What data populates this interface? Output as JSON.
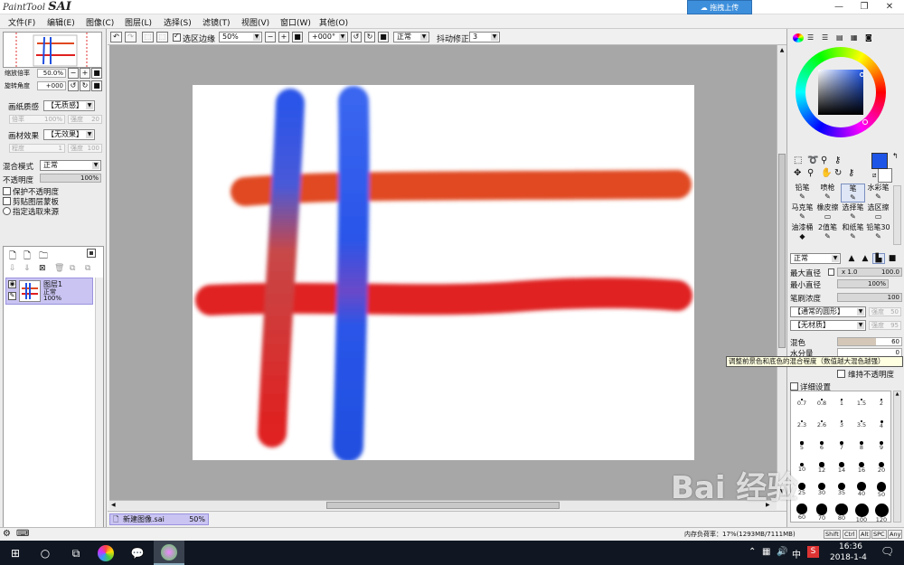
{
  "title": {
    "logo_small": "PaintTool",
    "logo_big": "SAI",
    "upload": "拖拽上传"
  },
  "window_controls": {
    "minimize": "—",
    "restore": "❐",
    "close": "✕"
  },
  "menu": [
    "文件(F)",
    "编辑(E)",
    "图像(C)",
    "图层(L)",
    "选择(S)",
    "滤镜(T)",
    "视图(V)",
    "窗口(W)",
    "其他(O)"
  ],
  "navigator": {
    "zoom_label": "缩放倍率",
    "zoom_value": "50.0%",
    "rotate_label": "旋转角度",
    "rotate_value": "+000"
  },
  "paper": {
    "texture_label": "画纸质感",
    "texture_value": "【无质感】",
    "scale_label": "倍率",
    "scale_value": "100%",
    "strength_label": "强度",
    "strength_value": "20"
  },
  "effect": {
    "label": "画材效果",
    "value": "【无效果】",
    "degree_label": "程度",
    "degree_value": "1",
    "strength_label": "强度",
    "strength_value": "100"
  },
  "blend": {
    "label": "混合模式",
    "value": "正常",
    "opacity_label": "不透明度",
    "opacity_value": "100%"
  },
  "layer_options": [
    "保护不透明度",
    "剪贴图层蒙板",
    "指定选取来源"
  ],
  "layer": {
    "name": "图层1",
    "mode": "正常",
    "opacity": "100%"
  },
  "toolbar": {
    "selection_edge": "选区边缘",
    "zoom": "50%",
    "angle": "+000°",
    "mode": "正常",
    "stabilizer_label": "抖动修正",
    "stabilizer_value": "3"
  },
  "doc_tab": {
    "name": "新建图像.sai",
    "zoom": "50%"
  },
  "canvas_strokes": {
    "colors": {
      "orange": "#e04820",
      "red": "#e02020",
      "blue": "#2050e0",
      "blue_light": "#3a6cf0"
    }
  },
  "colors": {
    "current": "#1e55e6",
    "background": "#ffffff",
    "layer_select": "#c9c4f2",
    "toolbar_bg": "#f0f0f0"
  },
  "tools": [
    [
      "铅笔",
      "喷枪",
      "笔",
      "水彩笔"
    ],
    [
      "马克笔",
      "橡皮擦",
      "选择笔",
      "选区擦"
    ],
    [
      "油漆桶",
      "2值笔",
      "和纸笔",
      "铅笔30"
    ]
  ],
  "tool_icons": [
    "pencil-icon",
    "airbrush-icon",
    "pen-icon",
    "watercolor-icon",
    "marker-icon",
    "eraser-icon",
    "select-pen-icon",
    "select-eraser-icon",
    "bucket-icon",
    "binary-pen-icon",
    "washi-pen-icon",
    "pencil30-icon"
  ],
  "brush": {
    "mode": "正常",
    "max_diameter_label": "最大直径",
    "max_diameter_multiplier": "x 1.0",
    "max_diameter_value": "100.0",
    "min_diameter_label": "最小直径",
    "min_diameter_value": "100%",
    "density_label": "笔刷浓度",
    "density_value": "100",
    "shape_value": "【通常的圆形】",
    "shape_strength_label": "强度",
    "shape_strength_value": "50",
    "texture_value": "【无材质】",
    "texture_strength_label": "强度",
    "texture_strength_value": "95",
    "blending_label": "混色",
    "blending_value": "60",
    "dilution_label": "水分量",
    "dilution_value": "0",
    "keep_opacity": "维持不透明度",
    "advanced": "详细设置"
  },
  "tooltip": "调整前景色和底色的混合程度（数值越大混色越强）",
  "brush_sizes": [
    "0.7",
    "0.8",
    "1",
    "1.5",
    "2",
    "2.3",
    "2.6",
    "3",
    "3.5",
    "4",
    "5",
    "6",
    "7",
    "8",
    "9",
    "10",
    "12",
    "14",
    "16",
    "20",
    "25",
    "30",
    "35",
    "40",
    "50",
    "60",
    "70",
    "80",
    "100",
    "120"
  ],
  "status": {
    "memory": "内存负荷率：17%(1293MB/7111MB)",
    "keys": [
      "Shift",
      "Ctrl",
      "Alt",
      "SPC",
      "Any"
    ]
  },
  "taskbar": {
    "time": "16:36",
    "date": "2018-1-4",
    "ime": "中"
  },
  "watermark": "Bai 经验"
}
